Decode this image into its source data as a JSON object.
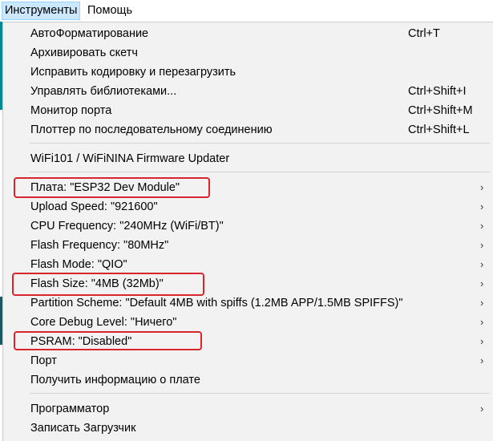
{
  "menubar": {
    "tools": "Инструменты",
    "help": "Помощь"
  },
  "menu": {
    "items": [
      {
        "label": "АвтоФорматирование",
        "shortcut": "Ctrl+T"
      },
      {
        "label": "Архивировать скетч"
      },
      {
        "label": "Исправить кодировку и перезагрузить"
      },
      {
        "label": "Управлять библиотеками...",
        "shortcut": "Ctrl+Shift+I"
      },
      {
        "label": "Монитор порта",
        "shortcut": "Ctrl+Shift+M"
      },
      {
        "label": "Плоттер по последовательному соединению",
        "shortcut": "Ctrl+Shift+L"
      },
      {
        "label": "WiFi101 / WiFiNINA Firmware Updater"
      },
      {
        "label": "Плата: \"ESP32 Dev Module\"",
        "submenu": true
      },
      {
        "label": "Upload Speed: \"921600\"",
        "submenu": true
      },
      {
        "label": "CPU Frequency: \"240MHz (WiFi/BT)\"",
        "submenu": true
      },
      {
        "label": "Flash Frequency: \"80MHz\"",
        "submenu": true
      },
      {
        "label": "Flash Mode: \"QIO\"",
        "submenu": true
      },
      {
        "label": "Flash Size: \"4MB (32Mb)\"",
        "submenu": true
      },
      {
        "label": "Partition Scheme: \"Default 4MB with spiffs (1.2MB APP/1.5MB SPIFFS)\"",
        "submenu": true
      },
      {
        "label": "Core Debug Level: \"Ничего\"",
        "submenu": true
      },
      {
        "label": "PSRAM: \"Disabled\"",
        "submenu": true
      },
      {
        "label": "Порт",
        "submenu": true
      },
      {
        "label": "Получить информацию о плате"
      },
      {
        "label": "Программатор",
        "submenu": true
      },
      {
        "label": "Записать Загрузчик"
      }
    ],
    "submenu_arrow": "›"
  },
  "highlight_color": "#d9262e",
  "menubar_active_color": "#cce8ff",
  "app_accent_color": "#00878f"
}
